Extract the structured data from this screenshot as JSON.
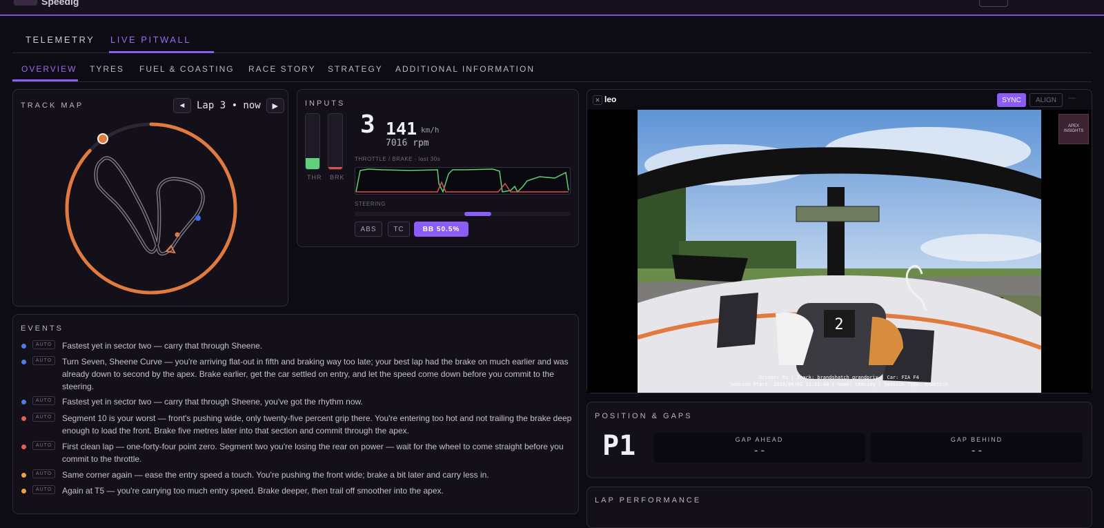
{
  "app": {
    "brand": "Speedig"
  },
  "main_tabs": [
    "TELEMETRY",
    "LIVE PITWALL"
  ],
  "sub_tabs": [
    "OVERVIEW",
    "TYRES",
    "FUEL & COASTING",
    "RACE STORY",
    "STRATEGY",
    "ADDITIONAL INFORMATION"
  ],
  "track_map": {
    "title": "TRACK MAP",
    "prev_icon": "◄",
    "lap_label": "Lap 3 • now",
    "next_icon": "▶",
    "progress_fraction": 0.87,
    "colors": {
      "arc": "#e07a3f",
      "track": "#8e8a9c",
      "marker": "#3b6ee8"
    }
  },
  "inputs": {
    "title": "INPUTS",
    "gear": "3",
    "speed": "141",
    "speed_unit": "km/h",
    "rpm": "7016 rpm",
    "throttle_label": "THR",
    "brake_label": "BRK",
    "throttle_fraction": 0.2,
    "brake_fraction": 0.04,
    "trace_label": "THROTTLE / BRAKE · last 30s",
    "steering_label": "STEERING",
    "steering_fraction": 0.55,
    "chips": {
      "abs": "ABS",
      "tc": "TC",
      "bb": "BB 50.5%"
    },
    "colors": {
      "throttle": "#5fd17a",
      "brake": "#e0504f",
      "accent": "#8b5cf6"
    }
  },
  "events": {
    "title": "EVENTS",
    "items": [
      {
        "color": "#4f7de8",
        "tag": "AUTO",
        "text": "Fastest yet in sector two — carry that through Sheene."
      },
      {
        "color": "#4f7de8",
        "tag": "AUTO",
        "text": "Turn Seven, Sheene Curve — you're arriving flat-out in fifth and braking way too late; your best lap had the brake on much earlier and was already down to second by the apex. Brake earlier, get the car settled on entry, and let the speed come down before you commit to the steering."
      },
      {
        "color": "#4f7de8",
        "tag": "AUTO",
        "text": "Fastest yet in sector two — carry that through Sheene, you've got the rhythm now."
      },
      {
        "color": "#e0605a",
        "tag": "AUTO",
        "text": "Segment 10 is your worst — front's pushing wide, only twenty-five percent grip there. You're entering too hot and not trailing the brake deep enough to load the front. Brake five metres later into that section and commit through the apex."
      },
      {
        "color": "#e0605a",
        "tag": "AUTO",
        "text": "First clean lap — one-forty-four point zero. Segment two you're losing the rear on power — wait for the wheel to come straight before you commit to the throttle."
      },
      {
        "color": "#f0a040",
        "tag": "AUTO",
        "text": "Same corner again — ease the entry speed a touch. You're pushing the front wide; brake a bit later and carry less in."
      },
      {
        "color": "#f0a040",
        "tag": "AUTO",
        "text": "Again at T5 — you're carrying too much entry speed. Brake deeper, then trail off smoother into the apex."
      }
    ]
  },
  "video": {
    "close_icon": "✕",
    "driver_name": "leo",
    "sync_label": "SYNC",
    "align_label": "ALIGN",
    "minimize_icon": "—",
    "logo_text": "APEX INSIGHTS",
    "overlay_line1": "Driver: Oz    |    Track: brandshatch grandprix    |    Car: FIA F4",
    "overlay_line2": "Session Start: 2026/08/01 13:21:48    |    Game: iRacing    |    Session Type: Practice",
    "dash_gear": "2"
  },
  "position_gaps": {
    "title": "POSITION & GAPS",
    "position": "P1",
    "gap_ahead_label": "GAP AHEAD",
    "gap_ahead_value": "--",
    "gap_behind_label": "GAP BEHIND",
    "gap_behind_value": "--"
  },
  "lap_performance": {
    "title": "LAP PERFORMANCE"
  }
}
